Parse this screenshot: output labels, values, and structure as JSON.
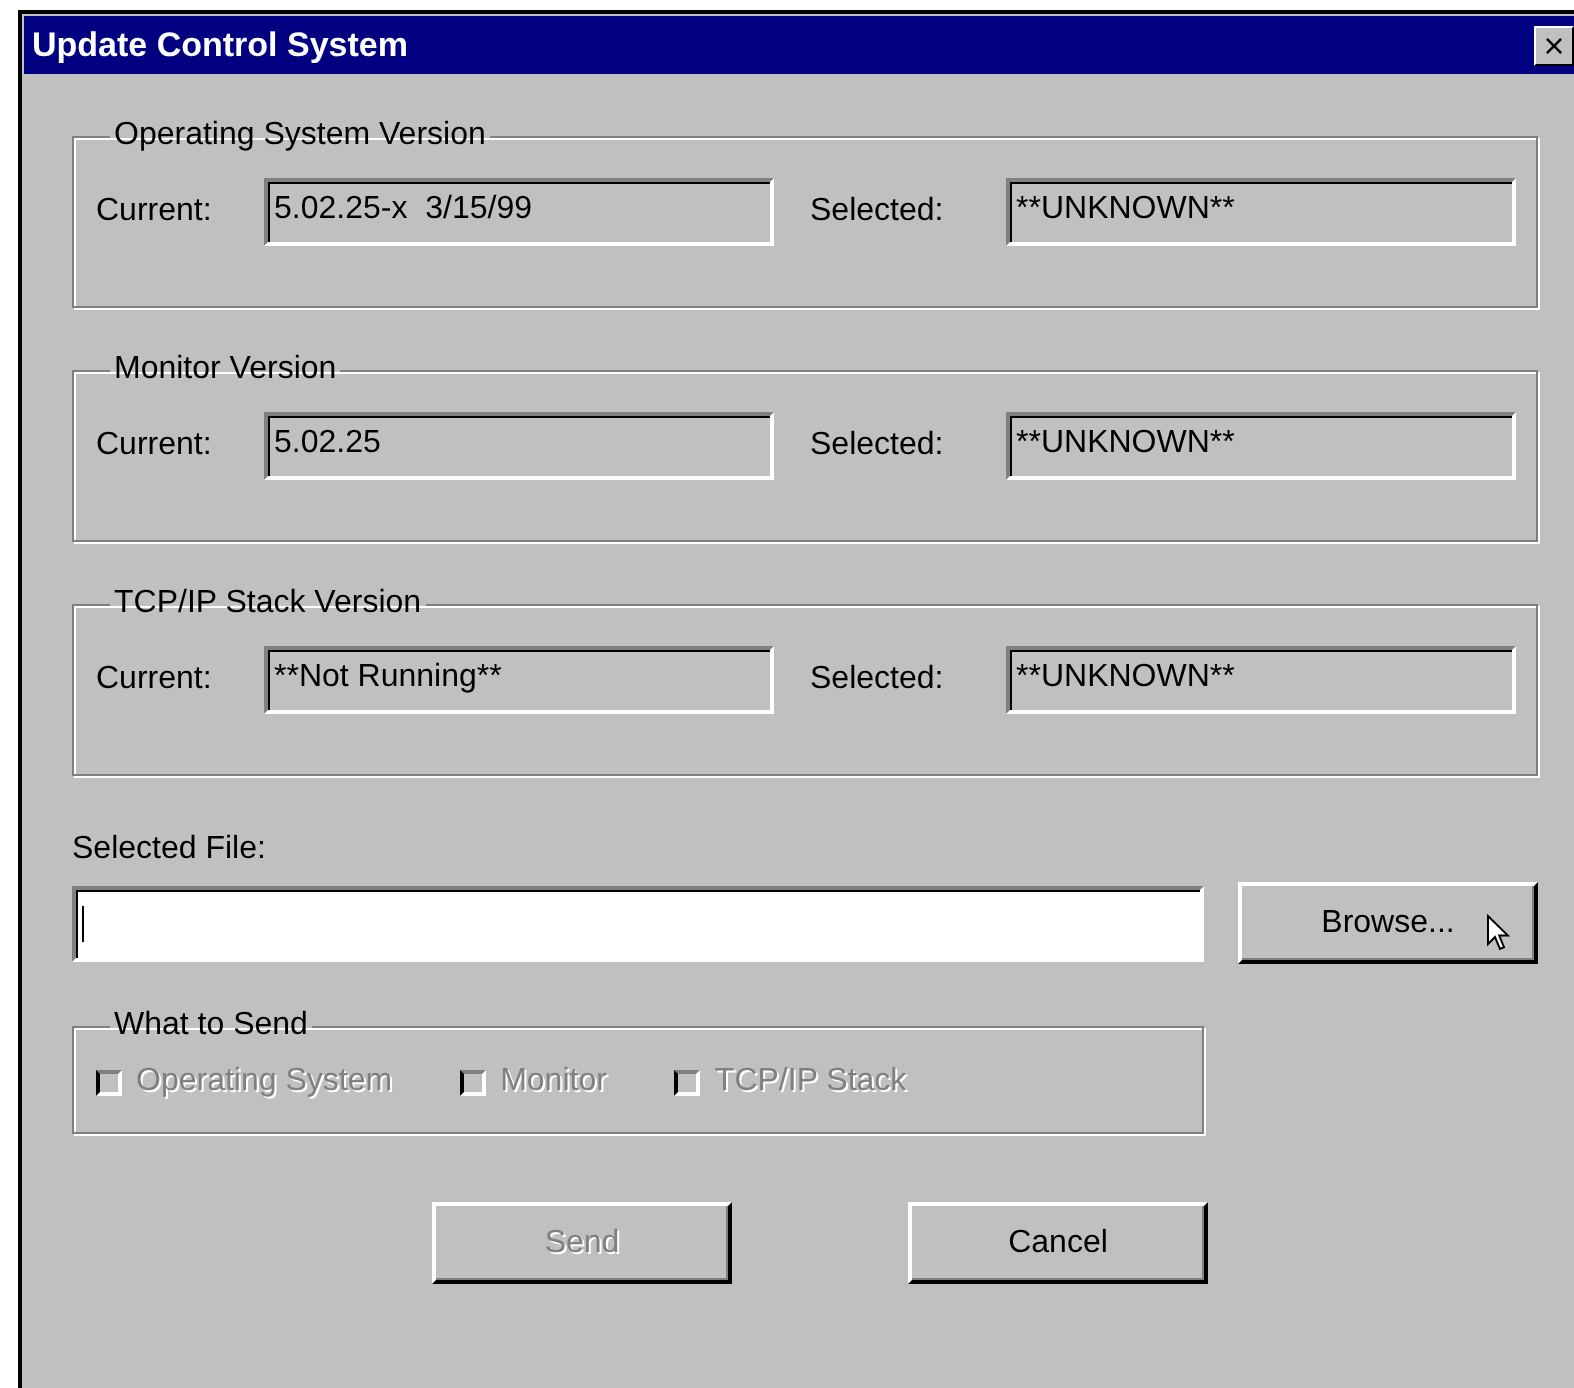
{
  "window": {
    "title": "Update Control System",
    "close": "×"
  },
  "version_groups": [
    {
      "title": "Operating System Version",
      "current_label": "Current:",
      "current": "5.02.25-x  3/15/99",
      "selected_label": "Selected:",
      "selected": "**UNKNOWN**"
    },
    {
      "title": "Monitor Version",
      "current_label": "Current:",
      "current": "5.02.25",
      "selected_label": "Selected:",
      "selected": "**UNKNOWN**"
    },
    {
      "title": "TCP/IP Stack Version",
      "current_label": "Current:",
      "current": "**Not Running**",
      "selected_label": "Selected:",
      "selected": "**UNKNOWN**"
    }
  ],
  "selected_file": {
    "label": "Selected File:",
    "browse": "Browse..."
  },
  "what_to_send": {
    "title": "What to Send",
    "options": [
      {
        "label": "Operating System",
        "checked": false,
        "disabled": true
      },
      {
        "label": "Monitor",
        "checked": false,
        "disabled": true
      },
      {
        "label": "TCP/IP Stack",
        "checked": false,
        "disabled": true
      }
    ]
  },
  "buttons": [
    {
      "label": "Send",
      "disabled": true
    },
    {
      "label": "Cancel",
      "disabled": false
    }
  ]
}
